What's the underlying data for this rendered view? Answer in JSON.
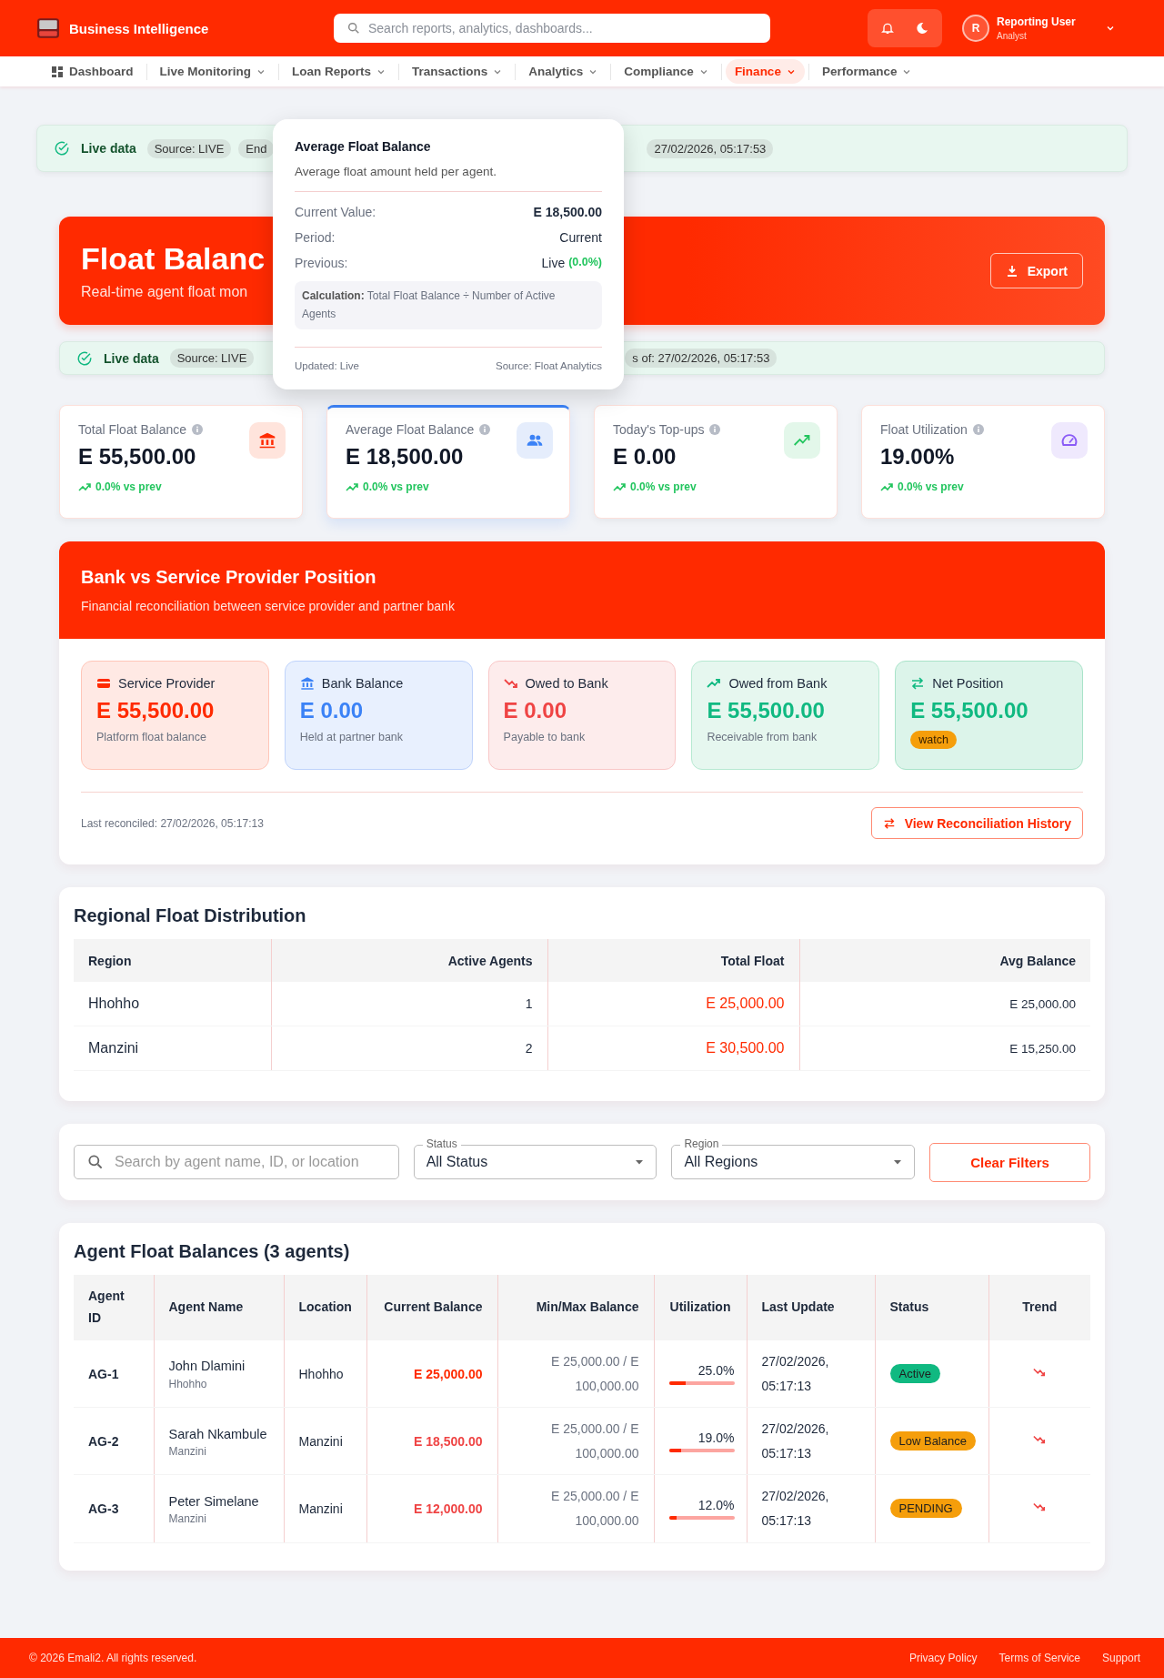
{
  "header": {
    "brand": "Business Intelligence",
    "search_placeholder": "Search reports, analytics, dashboards...",
    "user": {
      "initial": "R",
      "name": "Reporting User",
      "role": "Analyst"
    }
  },
  "nav": [
    {
      "label": "Dashboard",
      "kind": "home",
      "selected": false
    },
    {
      "label": "Live Monitoring",
      "kind": "menu",
      "selected": false
    },
    {
      "label": "Loan Reports",
      "kind": "menu",
      "selected": false
    },
    {
      "label": "Transactions",
      "kind": "menu",
      "selected": false
    },
    {
      "label": "Analytics",
      "kind": "menu",
      "selected": false
    },
    {
      "label": "Compliance",
      "kind": "menu",
      "selected": false
    },
    {
      "label": "Finance",
      "kind": "menu",
      "selected": true
    },
    {
      "label": "Performance",
      "kind": "menu",
      "selected": false
    }
  ],
  "live_bars": [
    {
      "label": "Live data",
      "chips": [
        "Source: LIVE",
        "End"
      ],
      "timestamp": "27/02/2026, 05:17:53"
    },
    {
      "label": "Live data",
      "chips": [
        "Source: LIVE"
      ],
      "timestamp": "s of: 27/02/2026, 05:17:53"
    }
  ],
  "hero": {
    "title": "Float Balanc",
    "subtitle": "Real-time agent float mon",
    "export": "Export"
  },
  "tooltip": {
    "title": "Average Float Balance",
    "description": "Average float amount held per agent.",
    "rows": [
      {
        "label": "Current Value:",
        "value": "E 18,500.00",
        "kind": "strong"
      },
      {
        "label": "Period:",
        "value": "Current",
        "kind": "plain"
      },
      {
        "label": "Previous:",
        "value": "Live",
        "change": "(0.0%)",
        "kind": "plain"
      }
    ],
    "calculation": "**Calculation:** Total Float Balance ÷ Number of Active Agents",
    "updated": "Updated: Live",
    "source": "Source: Float Analytics"
  },
  "kpis": [
    {
      "label": "Total Float Balance",
      "value": "E 55,500.00",
      "change": "0.0% vs prev",
      "kind": "bank",
      "selected": false
    },
    {
      "label": "Average Float Balance",
      "value": "E 18,500.00",
      "change": "0.0% vs prev",
      "kind": "people",
      "selected": true
    },
    {
      "label": "Today's Top-ups",
      "value": "E 0.00",
      "change": "0.0% vs prev",
      "kind": "trend",
      "selected": false
    },
    {
      "label": "Float Utilization",
      "value": "19.00%",
      "change": "0.0% vs prev",
      "kind": "gauge",
      "selected": false
    }
  ],
  "bank": {
    "title": "Bank vs Service Provider Position",
    "subtitle": "Financial reconciliation between service provider and partner bank",
    "cards": [
      {
        "kind": "provider",
        "label": "Service Provider",
        "value": "E 55,500.00",
        "note": "Platform float balance"
      },
      {
        "kind": "bank",
        "label": "Bank Balance",
        "value": "E 0.00",
        "note": "Held at partner bank"
      },
      {
        "kind": "owed_to",
        "label": "Owed to Bank",
        "value": "E 0.00",
        "note": "Payable to bank"
      },
      {
        "kind": "owed_from",
        "label": "Owed from Bank",
        "value": "E 55,500.00",
        "note": "Receivable from bank"
      },
      {
        "kind": "net",
        "label": "Net Position",
        "value": "E 55,500.00",
        "badge": "watch"
      }
    ],
    "last_reconciled": "Last reconciled: 27/02/2026, 05:17:13",
    "history_button": "View Reconciliation History"
  },
  "regional": {
    "title": "Regional Float Distribution",
    "columns": [
      "Region",
      "Active Agents",
      "Total Float",
      "Avg Balance"
    ],
    "rows": [
      [
        "Hhohho",
        "1",
        "E 25,000.00",
        "E 25,000.00"
      ],
      [
        "Manzini",
        "2",
        "E 30,500.00",
        "E 15,250.00"
      ]
    ]
  },
  "filters": {
    "search_placeholder": "Search by agent name, ID, or location",
    "selects": [
      {
        "label": "Status",
        "value": "All Status"
      },
      {
        "label": "Region",
        "value": "All Regions"
      }
    ],
    "clear": "Clear Filters"
  },
  "agents": {
    "title": "Agent Float Balances (3 agents)",
    "columns": [
      "Agent ID",
      "Agent Name",
      "Location",
      "Current Balance",
      "Min/Max Balance",
      "Utilization",
      "Last Update",
      "Status",
      "Trend"
    ],
    "rows": [
      {
        "id": "AG-1",
        "name": "John Dlamini",
        "sub": "Hhohho",
        "location": "Hhohho",
        "balance": "E 25,000.00",
        "minmax": "E 25,000.00 / E 100,000.00",
        "utilization": "25.0%",
        "level": 0.25,
        "updated": "27/02/2026, 05:17:13",
        "status": "Active",
        "color": "#10b981"
      },
      {
        "id": "AG-2",
        "name": "Sarah Nkambule",
        "sub": "Manzini",
        "location": "Manzini",
        "balance": "E 18,500.00",
        "minmax": "E 25,000.00 / E 100,000.00",
        "utilization": "19.0%",
        "level": 0.19,
        "updated": "27/02/2026, 05:17:13",
        "status": "Low Balance",
        "color": "#f59e0b"
      },
      {
        "id": "AG-3",
        "name": "Peter Simelane",
        "sub": "Manzini",
        "location": "Manzini",
        "balance": "E 12,000.00",
        "minmax": "E 25,000.00 / E 100,000.00",
        "utilization": "12.0%",
        "level": 0.12,
        "updated": "27/02/2026, 05:17:13",
        "status": "PENDING",
        "color": "#f59e0b"
      }
    ]
  },
  "footer": {
    "copyright": "© 2026 Emali2. All rights reserved.",
    "links": [
      "Privacy Policy",
      "Terms of Service",
      "Support"
    ]
  }
}
